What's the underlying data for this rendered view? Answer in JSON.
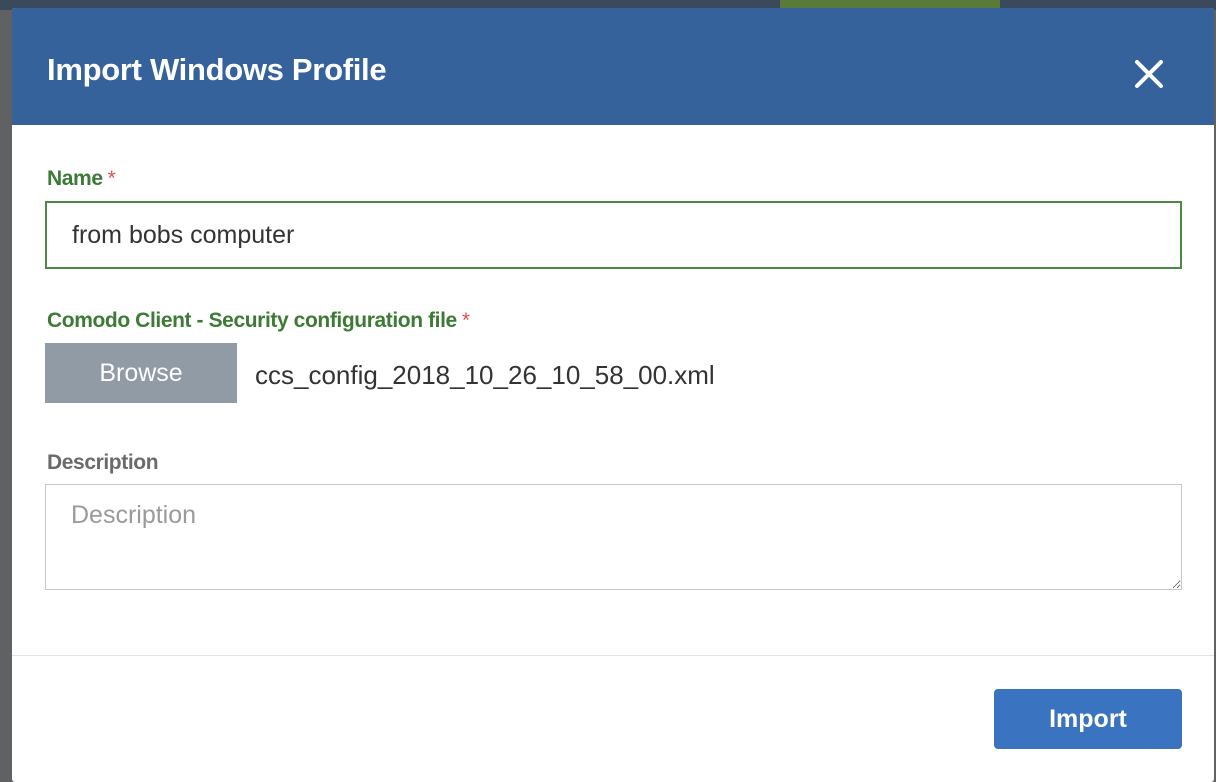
{
  "dialog": {
    "title": "Import Windows Profile"
  },
  "form": {
    "name": {
      "label": "Name",
      "required_mark": "*",
      "value": "from bobs computer"
    },
    "config_file": {
      "label": "Comodo Client - Security configuration file",
      "required_mark": "*",
      "browse_label": "Browse",
      "file_name": "ccs_config_2018_10_26_10_58_00.xml"
    },
    "description": {
      "label": "Description",
      "placeholder": "Description",
      "value": ""
    }
  },
  "footer": {
    "import_label": "Import"
  },
  "icons": {
    "close": "close-icon"
  },
  "colors": {
    "header_bg": "#35629b",
    "label_green": "#3d7a35",
    "required_red": "#d9534f",
    "browse_bg": "#909ba6",
    "import_bg": "#3a73c0"
  }
}
